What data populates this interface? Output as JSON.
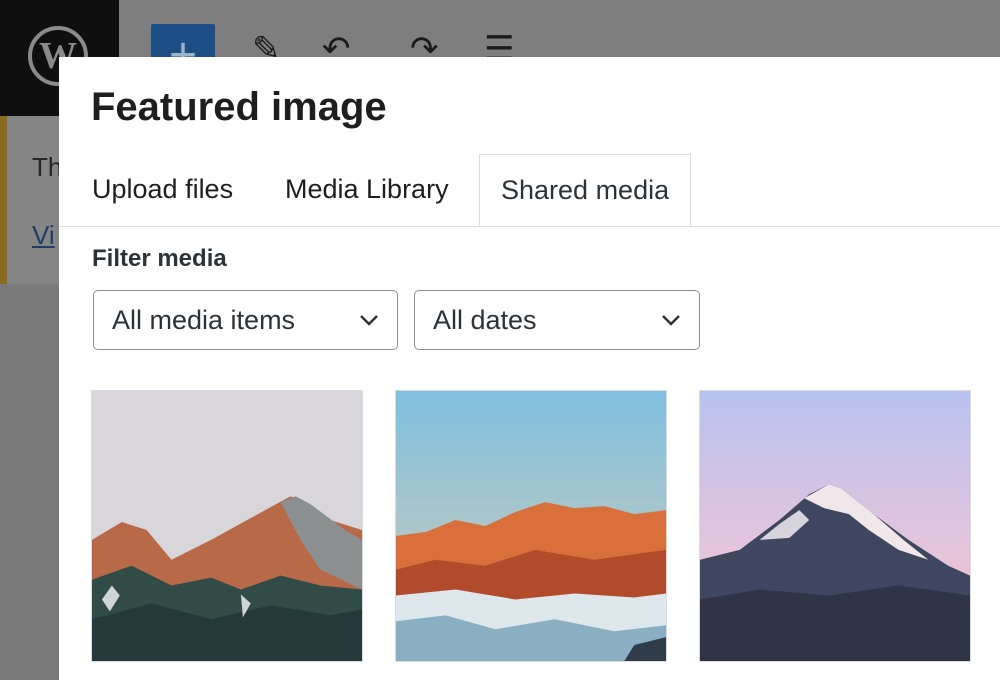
{
  "editor": {
    "logo_glyph": "W",
    "add_icon": "plus-icon",
    "toolbar_icons": [
      "pencil-icon",
      "undo-icon",
      "redo-icon",
      "list-view-icon"
    ],
    "notice_text": "Th",
    "notice_link": "Vi"
  },
  "modal": {
    "title": "Featured image",
    "tabs": [
      {
        "label": "Upload files",
        "active": false
      },
      {
        "label": "Media Library",
        "active": false
      },
      {
        "label": "Shared media",
        "active": true
      }
    ],
    "filter_label": "Filter media",
    "filters": {
      "type_selected": "All media items",
      "date_selected": "All dates"
    },
    "media_items": [
      {
        "icon": "mountain-photo",
        "palette": [
          "#d6d5d8",
          "#c2704a",
          "#2f4a48"
        ]
      },
      {
        "icon": "mountain-sunset-photo",
        "palette": [
          "#8fc2dc",
          "#e07a45",
          "#dde6ea"
        ]
      },
      {
        "icon": "snowy-peak-photo",
        "palette": [
          "#c9b8e8",
          "#f2dfe6",
          "#3a4258"
        ]
      }
    ]
  }
}
